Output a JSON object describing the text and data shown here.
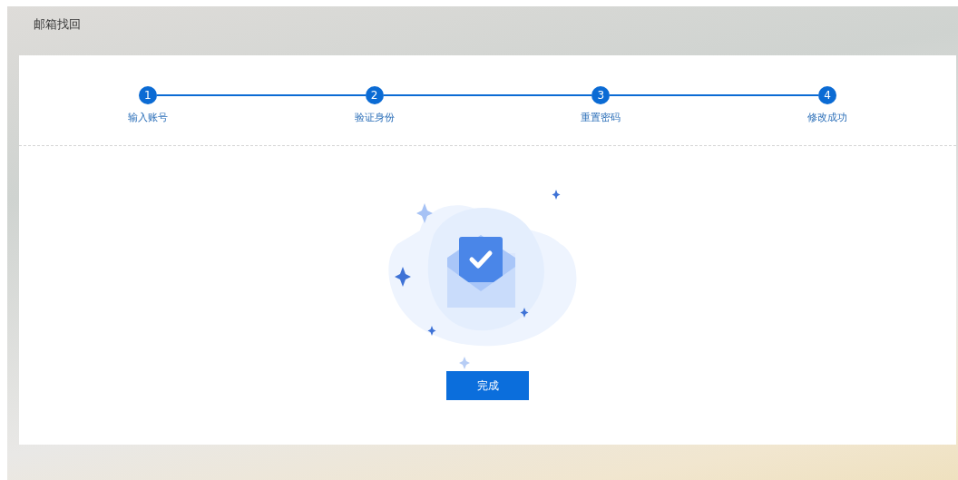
{
  "page_title": "邮箱找回",
  "steps": [
    {
      "number": "1",
      "label": "输入账号",
      "done": true
    },
    {
      "number": "2",
      "label": "验证身份",
      "done": true
    },
    {
      "number": "3",
      "label": "重置密码",
      "done": true
    },
    {
      "number": "4",
      "label": "修改成功",
      "done": true
    }
  ],
  "button": "完成"
}
